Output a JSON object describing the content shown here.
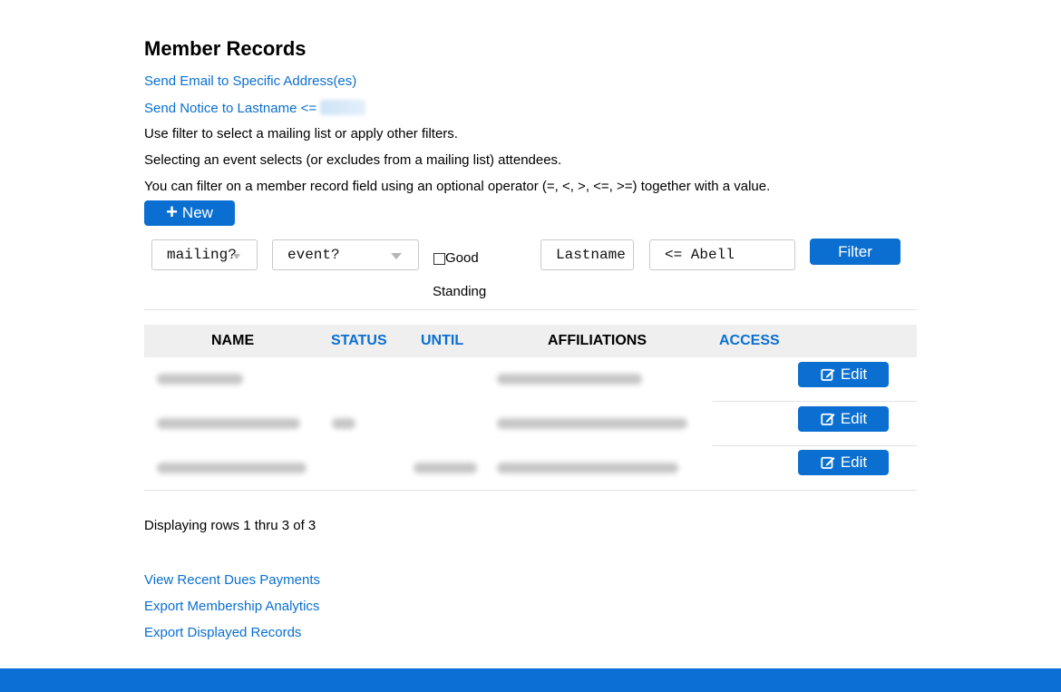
{
  "page": {
    "title": "Member Records",
    "send_email_link": "Send Email to Specific Address(es)",
    "send_notice_link": "Send Notice to Lastname <= ",
    "help_lines": [
      "Use filter to select a mailing list or apply other filters.",
      "Selecting an event selects (or excludes from a mailing list) attendees.",
      "You can filter on a member record field using an optional operator (=, <, >, <=, >=) together with a value."
    ]
  },
  "toolbar": {
    "new_label": "New",
    "new_icon": "plus-icon"
  },
  "filters": {
    "mailing_select": "mailing?",
    "event_select": "event?",
    "good_standing_checked": false,
    "good_standing_label_1": "Good",
    "good_standing_label_2": "Standing",
    "field_value": "Lastname",
    "operator_value": "<= Abell",
    "filter_button": "Filter"
  },
  "table": {
    "headers": {
      "name": "NAME",
      "status": "STATUS",
      "until": "UNTIL",
      "affiliations": "AFFILIATIONS",
      "access": "ACCESS"
    },
    "rows": [
      {
        "name": "(redacted)",
        "status": "",
        "until": "",
        "affiliations": "(redacted)",
        "action": "Edit"
      },
      {
        "name": "(redacted)",
        "status": "(redacted)",
        "until": "",
        "affiliations": "(redacted)",
        "action": "Edit"
      },
      {
        "name": "(redacted)",
        "status": "",
        "until": "(redacted)",
        "affiliations": "(redacted)",
        "action": "Edit"
      }
    ],
    "edit_icon": "edit-icon"
  },
  "summary": "Displaying rows 1 thru 3 of 3",
  "bottom_links": {
    "dues": "View Recent Dues Payments",
    "analytics": "Export Membership Analytics",
    "export": "Export Displayed Records"
  },
  "colors": {
    "accent": "#0a6fd0",
    "footer": "#0a70d6",
    "header_bg": "#efefef"
  }
}
